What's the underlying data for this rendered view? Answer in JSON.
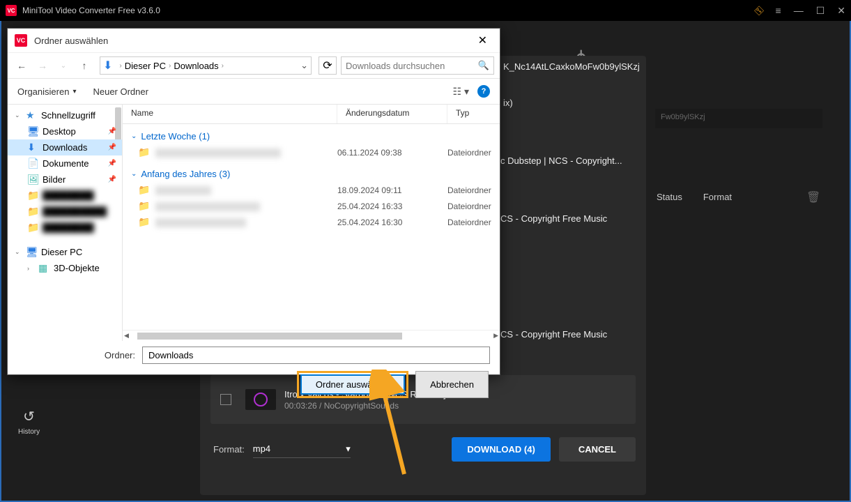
{
  "app": {
    "title": "MiniTool Video Converter Free v3.6.0"
  },
  "background": {
    "url_fragment_top": "K_Nc14AtLCaxkoMoFw0b9ylSKzj",
    "url_fragment_line": "Fw0b9ylSKzj",
    "mix_text": "ix)",
    "row1": "c Dubstep | NCS - Copyright...",
    "row2": "CS - Copyright Free Music",
    "row3": "CS - Copyright Free Music",
    "status_header": "Status",
    "format_header": "Format",
    "download_item_title": "Itro x Valcos - Starbound [NCS Release]",
    "download_item_meta": "00:03:26 / NoCopyrightSounds",
    "format_label": "Format:",
    "format_value": "mp4",
    "download_button": "DOWNLOAD (4)",
    "cancel_button": "CANCEL",
    "history_label": "History"
  },
  "dialog": {
    "title": "Ordner auswählen",
    "breadcrumb": {
      "pc": "Dieser PC",
      "folder": "Downloads"
    },
    "search_placeholder": "Downloads durchsuchen",
    "toolbar": {
      "organize": "Organisieren",
      "new_folder": "Neuer Ordner"
    },
    "tree": {
      "quick_access": "Schnellzugriff",
      "desktop": "Desktop",
      "downloads": "Downloads",
      "documents": "Dokumente",
      "pictures": "Bilder",
      "this_pc": "Dieser PC",
      "objects_3d": "3D-Objekte"
    },
    "columns": {
      "name": "Name",
      "modified": "Änderungsdatum",
      "type": "Typ"
    },
    "group_last_week": "Letzte Woche (1)",
    "group_start_year": "Anfang des Jahres (3)",
    "rows": [
      {
        "date": "06.11.2024 09:38",
        "type": "Dateiordner"
      },
      {
        "date": "18.09.2024 09:11",
        "type": "Dateiordner"
      },
      {
        "date": "25.04.2024 16:33",
        "type": "Dateiordner"
      },
      {
        "date": "25.04.2024 16:30",
        "type": "Dateiordner"
      }
    ],
    "folder_label": "Ordner:",
    "folder_value": "Downloads",
    "select_button": "Ordner auswählen",
    "cancel_button": "Abbrechen"
  }
}
